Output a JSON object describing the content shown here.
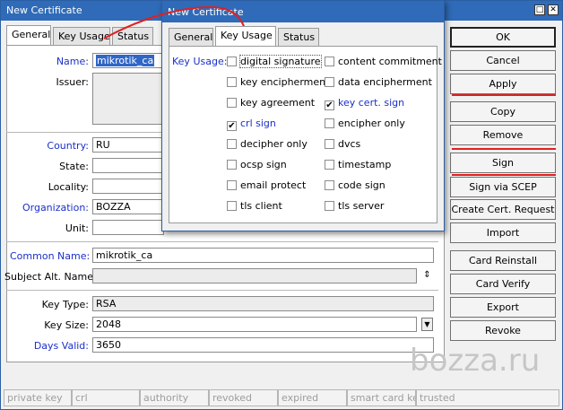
{
  "main": {
    "title": "New Certificate",
    "tabs": [
      "General",
      "Key Usage",
      "Status"
    ],
    "fields": {
      "name_label": "Name:",
      "name_value": "mikrotik_ca",
      "issuer_label": "Issuer:",
      "country_label": "Country:",
      "country_value": "RU",
      "state_label": "State:",
      "state_value": "",
      "locality_label": "Locality:",
      "locality_value": "",
      "organization_label": "Organization:",
      "organization_value": "BOZZA",
      "unit_label": "Unit:",
      "unit_value": "",
      "common_name_label": "Common Name:",
      "common_name_value": "mikrotik_ca",
      "san_label": "Subject Alt. Name:",
      "san_value": "",
      "key_type_label": "Key Type:",
      "key_type_value": "RSA",
      "key_size_label": "Key Size:",
      "key_size_value": "2048",
      "days_valid_label": "Days Valid:",
      "days_valid_value": "3650"
    }
  },
  "buttons": [
    "OK",
    "Cancel",
    "Apply",
    "Copy",
    "Remove",
    "Sign",
    "Sign via SCEP",
    "Create Cert. Request",
    "Import",
    "Card Reinstall",
    "Card Verify",
    "Export",
    "Revoke"
  ],
  "status_bar": [
    "private key",
    "crl",
    "authority",
    "revoked",
    "expired",
    "smart card key",
    "trusted"
  ],
  "dialog": {
    "title": "New Certificate",
    "tabs": [
      "General",
      "Key Usage",
      "Status"
    ],
    "key_usage_label": "Key Usage:",
    "left": [
      {
        "label": "digital signature",
        "checked": false
      },
      {
        "label": "key encipherment",
        "checked": false
      },
      {
        "label": "key agreement",
        "checked": false
      },
      {
        "label": "crl sign",
        "checked": true
      },
      {
        "label": "decipher only",
        "checked": false
      },
      {
        "label": "ocsp sign",
        "checked": false
      },
      {
        "label": "email protect",
        "checked": false
      },
      {
        "label": "tls client",
        "checked": false
      }
    ],
    "right": [
      {
        "label": "content commitment",
        "checked": false
      },
      {
        "label": "data encipherment",
        "checked": false
      },
      {
        "label": "key cert. sign",
        "checked": true
      },
      {
        "label": "encipher only",
        "checked": false
      },
      {
        "label": "dvcs",
        "checked": false
      },
      {
        "label": "timestamp",
        "checked": false
      },
      {
        "label": "code sign",
        "checked": false
      },
      {
        "label": "tls server",
        "checked": false
      }
    ]
  },
  "watermark": "bozza.ru",
  "colors": {
    "titlebar": "#2f6bb8",
    "label_blue": "#1a2fc9",
    "annotation_red": "#e02020"
  }
}
